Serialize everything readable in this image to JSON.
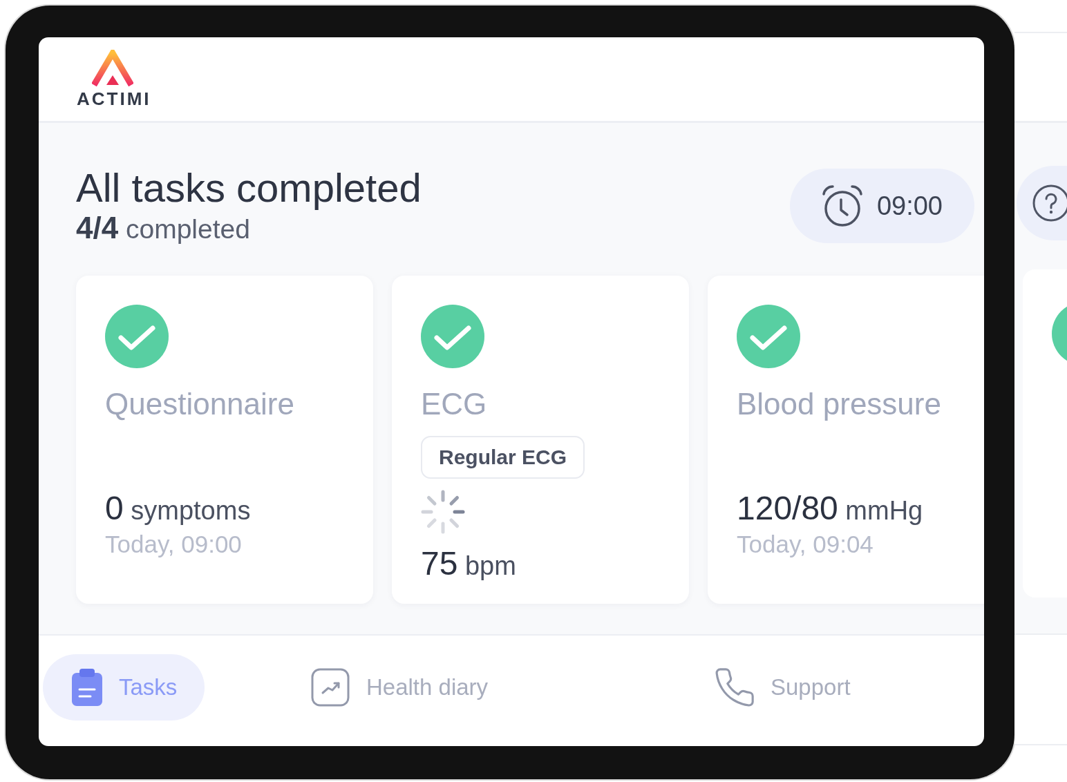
{
  "header": {
    "logo_text": "ACTIMI"
  },
  "summary": {
    "title": "All tasks completed",
    "progress": "**4/4** completed"
  },
  "reminder": {
    "time": "09:00"
  },
  "tasks": [
    {
      "name": "Questionnaire",
      "completed": true,
      "loading": false,
      "value": "**0** symptoms",
      "time": "Today, 09:00"
    },
    {
      "name": "ECG",
      "completed": true,
      "badge": "Regular ECG",
      "loading": true,
      "value": "**75** bpm"
    },
    {
      "name": "Blood pressure",
      "completed": true,
      "loading": false,
      "value": "**120/80** mmHg",
      "time": "Today, 09:04"
    }
  ],
  "nav": [
    {
      "label": "Tasks",
      "selected": true
    },
    {
      "label": "Health diary",
      "selected": false
    },
    {
      "label": "Support",
      "selected": false
    }
  ],
  "background_view": {
    "card": {
      "completed": true
    }
  }
}
